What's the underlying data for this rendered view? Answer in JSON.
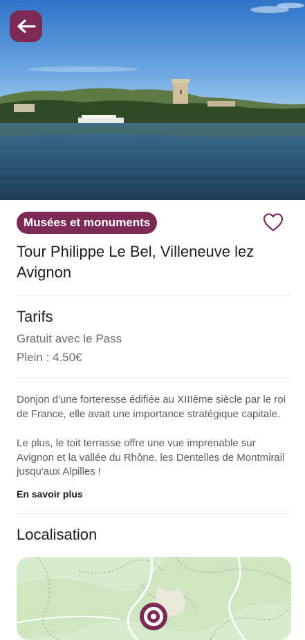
{
  "header": {
    "back_icon": "arrow-left-icon"
  },
  "category": {
    "label": "Musées et monuments"
  },
  "favorite": {
    "icon": "heart-outline-icon"
  },
  "title": "Tour Philippe Le Bel, Villeneuve lez Avignon",
  "pricing": {
    "heading": "Tarifs",
    "items": [
      "Gratuit avec le Pass",
      "Plein : 4.50€"
    ]
  },
  "description": {
    "paragraph_1": "Donjon d'une forteresse édifiée au XIIIème siècle par le roi de France, elle avait une importance stratégique capitale.",
    "paragraph_2": "Le plus, le toit terrasse offre une vue imprenable sur Avignon et la vallée du Rhône, les Dentelles de Montmirail jusqu'aux Alpilles !",
    "more_link": "En savoir plus"
  },
  "location": {
    "heading": "Localisation",
    "marker_icon": "map-pin-icon"
  },
  "colors": {
    "accent": "#7a2a55",
    "map_bg": "#d8eccd"
  }
}
